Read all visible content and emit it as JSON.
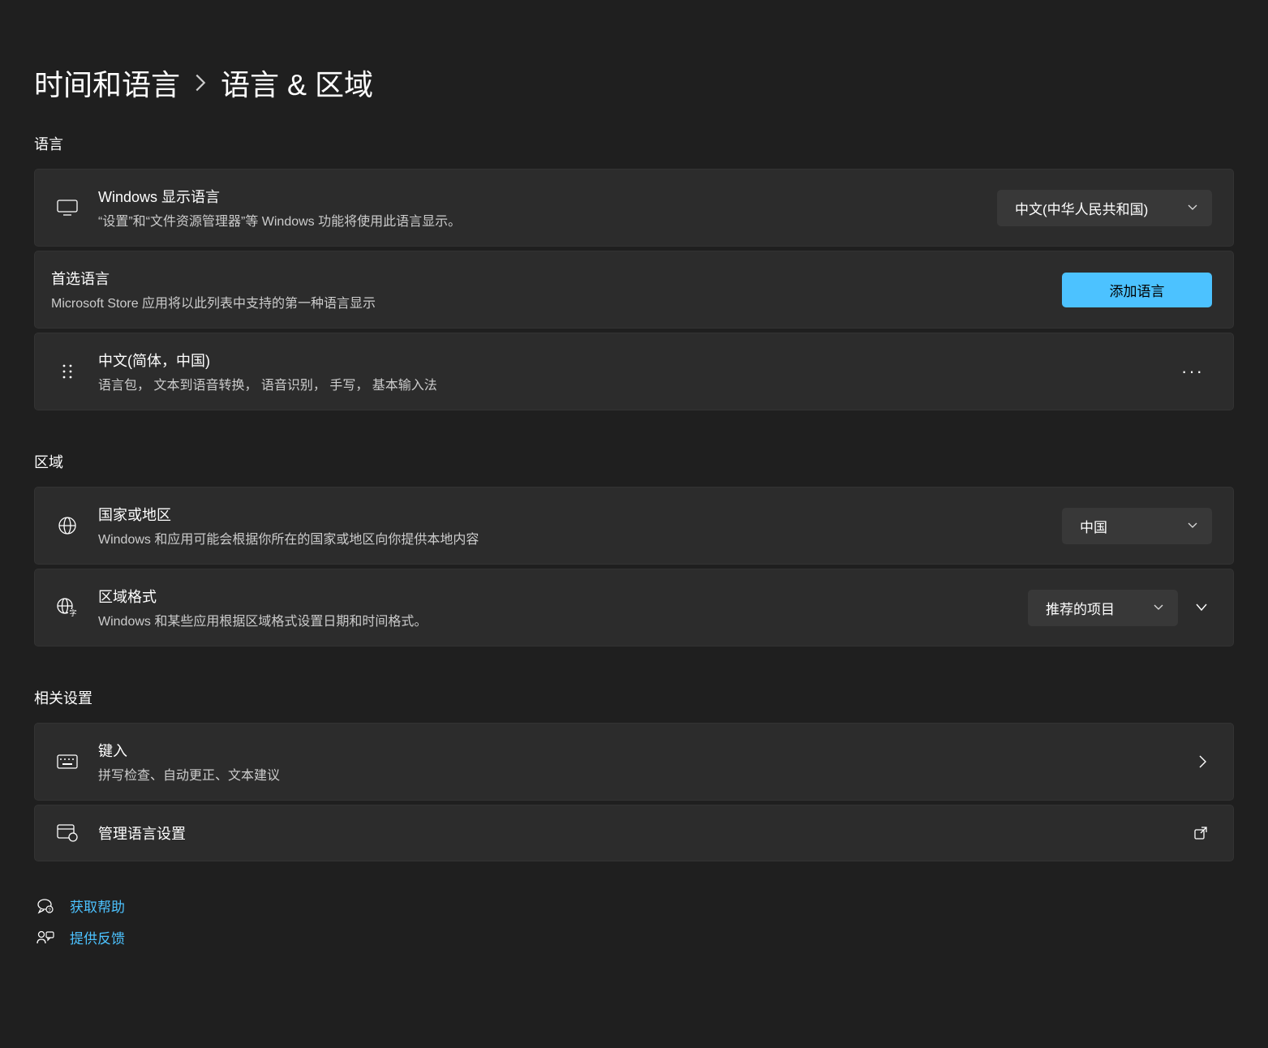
{
  "breadcrumb": {
    "parent": "时间和语言",
    "current": "语言 & 区域"
  },
  "sections": {
    "language": {
      "heading": "语言",
      "display_language": {
        "title": "Windows 显示语言",
        "subtitle": "“设置”和“文件资源管理器”等 Windows 功能将使用此语言显示。",
        "selected": "中文(中华人民共和国)"
      },
      "preferred_languages": {
        "title": "首选语言",
        "subtitle": "Microsoft Store 应用将以此列表中支持的第一种语言显示",
        "add_button": "添加语言"
      },
      "installed": [
        {
          "name": "中文(简体，中国)",
          "features": "语言包， 文本到语音转换， 语音识别， 手写， 基本输入法"
        }
      ]
    },
    "region": {
      "heading": "区域",
      "country": {
        "title": "国家或地区",
        "subtitle": "Windows 和应用可能会根据你所在的国家或地区向你提供本地内容",
        "selected": "中国"
      },
      "format": {
        "title": "区域格式",
        "subtitle": "Windows 和某些应用根据区域格式设置日期和时间格式。",
        "selected": "推荐的项目"
      }
    },
    "related": {
      "heading": "相关设置",
      "typing": {
        "title": "键入",
        "subtitle": "拼写检查、自动更正、文本建议"
      },
      "admin": {
        "title": "管理语言设置"
      }
    }
  },
  "links": {
    "help": "获取帮助",
    "feedback": "提供反馈"
  }
}
